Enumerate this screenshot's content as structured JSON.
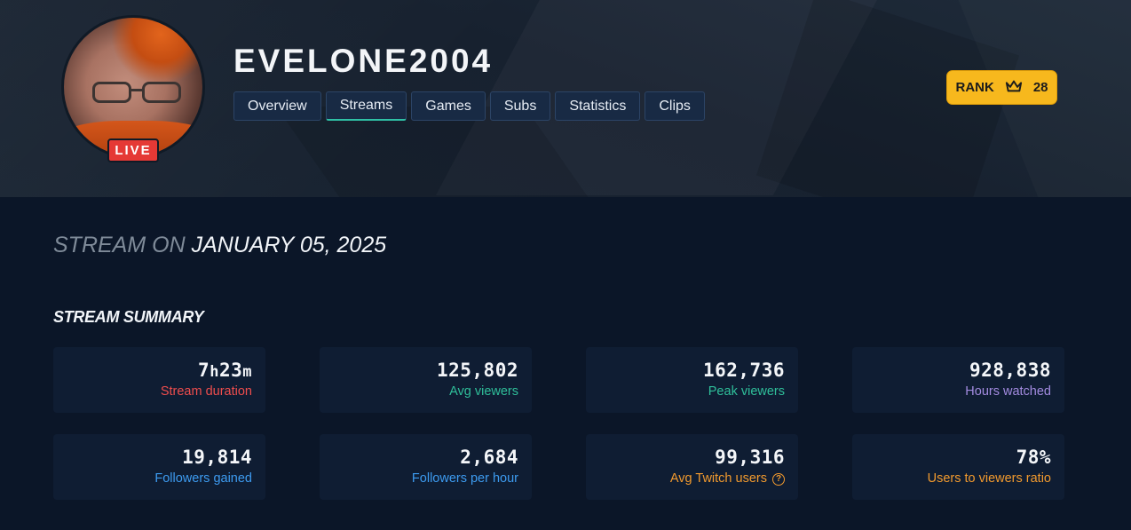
{
  "channel": {
    "name": "EVELONE2004",
    "live_badge": "LIVE"
  },
  "tabs": [
    {
      "label": "Overview",
      "active": false
    },
    {
      "label": "Streams",
      "active": true
    },
    {
      "label": "Games",
      "active": false
    },
    {
      "label": "Subs",
      "active": false
    },
    {
      "label": "Statistics",
      "active": false
    },
    {
      "label": "Clips",
      "active": false
    }
  ],
  "rank": {
    "label": "RANK",
    "icon": "crown-icon",
    "value": "28"
  },
  "page_title": {
    "prefix": "STREAM ON",
    "date": "JANUARY 05, 2025"
  },
  "summary": {
    "heading": "STREAM SUMMARY",
    "stats": [
      {
        "value_hours": "7",
        "value_h_unit": "h",
        "value_minutes": "23",
        "value_m_unit": "m",
        "label": "Stream duration",
        "color": "#ef4d4d"
      },
      {
        "value": "125,802",
        "label": "Avg viewers",
        "color": "#2fbf9a"
      },
      {
        "value": "162,736",
        "label": "Peak viewers",
        "color": "#2fbf9a"
      },
      {
        "value": "928,838",
        "label": "Hours watched",
        "color": "#a38be0"
      },
      {
        "value": "19,814",
        "label": "Followers gained",
        "color": "#3d9bf0"
      },
      {
        "value": "2,684",
        "label": "Followers per hour",
        "color": "#3d9bf0"
      },
      {
        "value": "99,316",
        "label": "Avg Twitch users",
        "color": "#f29a2e",
        "help_icon": "question-circle-icon",
        "help_glyph": "?"
      },
      {
        "value": "78%",
        "label": "Users to viewers ratio",
        "color": "#f29a2e"
      }
    ]
  },
  "colors": {
    "live": "#e53935",
    "rank": "#f7b81d",
    "active_tab_underline": "#2fbfa5"
  }
}
